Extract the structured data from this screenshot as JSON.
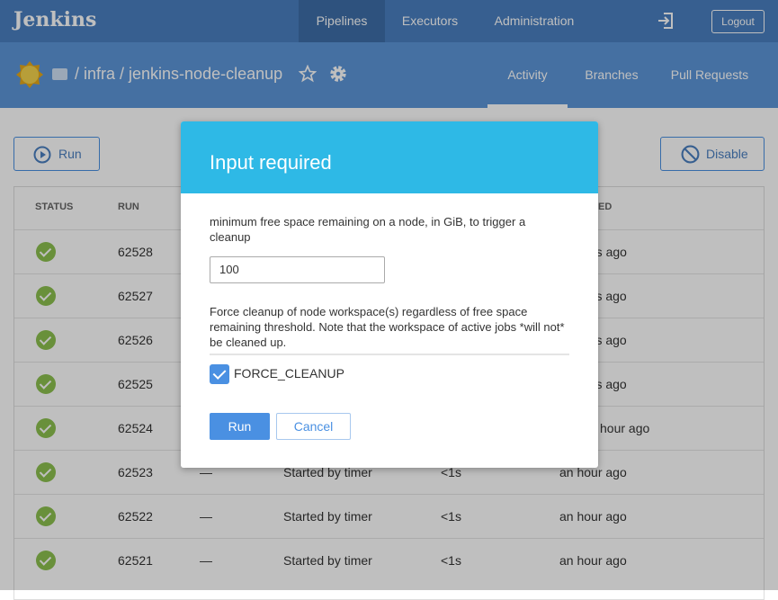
{
  "header": {
    "logo": "Jenkins",
    "nav": [
      {
        "label": "Pipelines",
        "active": true
      },
      {
        "label": "Executors"
      },
      {
        "label": "Administration"
      }
    ],
    "logout": "Logout"
  },
  "pipeline": {
    "breadcrumb": "/ infra / jenkins-node-cleanup",
    "tabs": [
      {
        "label": "Activity",
        "active": true
      },
      {
        "label": "Branches"
      },
      {
        "label": "Pull Requests"
      }
    ]
  },
  "actions": {
    "run": "Run",
    "disable": "Disable"
  },
  "table": {
    "headers": {
      "status": "STATUS",
      "run": "RUN",
      "completed": "ETED"
    },
    "rows": [
      {
        "status": "success",
        "run": "62528",
        "commit": "",
        "message": "",
        "duration": "",
        "completed": "tes ago"
      },
      {
        "status": "success",
        "run": "62527",
        "commit": "",
        "message": "",
        "duration": "",
        "completed": "utes ago"
      },
      {
        "status": "success",
        "run": "62526",
        "commit": "",
        "message": "",
        "duration": "",
        "completed": "utes ago"
      },
      {
        "status": "success",
        "run": "62525",
        "commit": "",
        "message": "",
        "duration": "",
        "completed": "utes ago"
      },
      {
        "status": "success",
        "run": "62524",
        "commit": "",
        "message": "",
        "duration": "",
        "completed": "hour ago"
      },
      {
        "status": "success",
        "run": "62523",
        "commit": "—",
        "message": "Started by timer",
        "duration": "<1s",
        "completed": "an hour ago"
      },
      {
        "status": "success",
        "run": "62522",
        "commit": "—",
        "message": "Started by timer",
        "duration": "<1s",
        "completed": "an hour ago"
      },
      {
        "status": "success",
        "run": "62521",
        "commit": "—",
        "message": "Started by timer",
        "duration": "<1s",
        "completed": "an hour ago"
      }
    ]
  },
  "modal": {
    "title": "Input required",
    "param1_desc": "minimum free space remaining on a node, in GiB, to trigger a cleanup",
    "param1_value": "100",
    "param2_desc": "Force cleanup of node workspace(s) regardless of free space remaining threshold. Note that the workspace of active jobs *will not* be cleaned up.",
    "checkbox_label": "FORCE_CLEANUP",
    "checkbox_checked": true,
    "run": "Run",
    "cancel": "Cancel"
  },
  "colors": {
    "topbar": "#4a7fc0",
    "subbar": "#5d96d8",
    "modal_header": "#2eb9e6",
    "primary": "#4a90e2",
    "success": "#8cc04f"
  }
}
